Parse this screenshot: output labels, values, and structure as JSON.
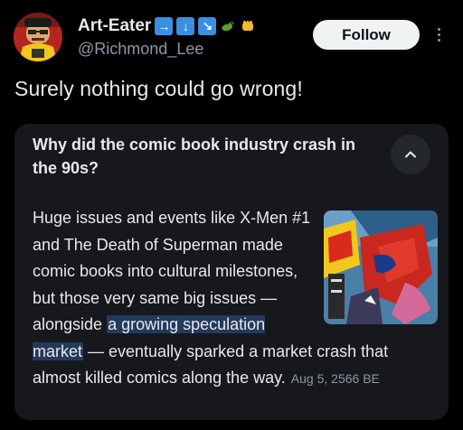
{
  "author": {
    "display_name": "Art-Eater",
    "name_emojis": {
      "arrow_right": "→",
      "arrow_down": "↓",
      "arrow_down_right": "↘",
      "dragon": "🐉",
      "fist": "👊"
    },
    "handle": "@Richmond_Lee",
    "avatar_icon": "avatar-illustration"
  },
  "actions": {
    "follow_label": "Follow",
    "more_icon": "more-vertical-icon"
  },
  "tweet": {
    "text": "Surely nothing could go wrong!"
  },
  "card": {
    "title": "Why did the comic book industry crash in the 90s?",
    "collapse_icon": "chevron-up-icon",
    "body_before": "Huge issues and events like X-Men #1 and The Death of Superman made comic books into cultural milestones, but those very same big issues — alongside ",
    "highlighted_text": "a growing speculation market",
    "body_after": " — eventually sparked a market crash that almost killed comics along the way.",
    "date": "Aug 5, 2566 BE",
    "thumbnail_icon": "comic-cover-thumbnail"
  },
  "colors": {
    "background": "#000000",
    "text": "#e7e9ea",
    "muted": "#8b98a5",
    "card_bg": "#16181c",
    "highlight_bg": "#233a5e",
    "emoji_blue": "#3a8fe0"
  }
}
